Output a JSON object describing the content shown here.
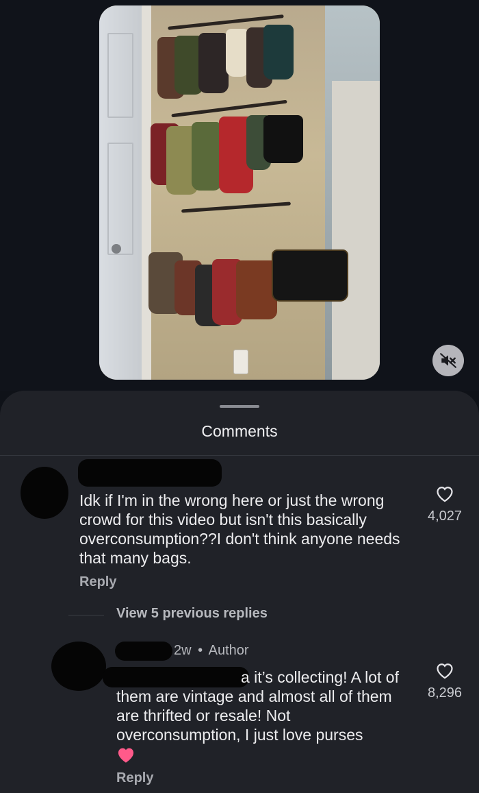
{
  "video": {
    "mute_icon": "volume-muted-icon"
  },
  "comments_sheet": {
    "title": "Comments",
    "comments": [
      {
        "text": "Idk if I'm in the wrong here or just the wrong crowd for this video but isn't this basically overconsumption??I don't think anyone needs that many bags.",
        "like_count": "4,027",
        "reply_label": "Reply"
      }
    ],
    "view_replies_label": "View 5 previous replies",
    "reply": {
      "age": "2w",
      "separator": "•",
      "author_badge": "Author",
      "text": "a it’s collecting! A lot of them are vintage and almost all of them are thrifted or resale! Not overconsumption, I just love purses",
      "emoji": "pink-heart-emoji",
      "like_count": "8,296",
      "reply_label": "Reply"
    }
  },
  "colors": {
    "background": "#0f1218",
    "sheet": "#202228",
    "text": "#ececee",
    "muted_text": "#b7b9be"
  }
}
